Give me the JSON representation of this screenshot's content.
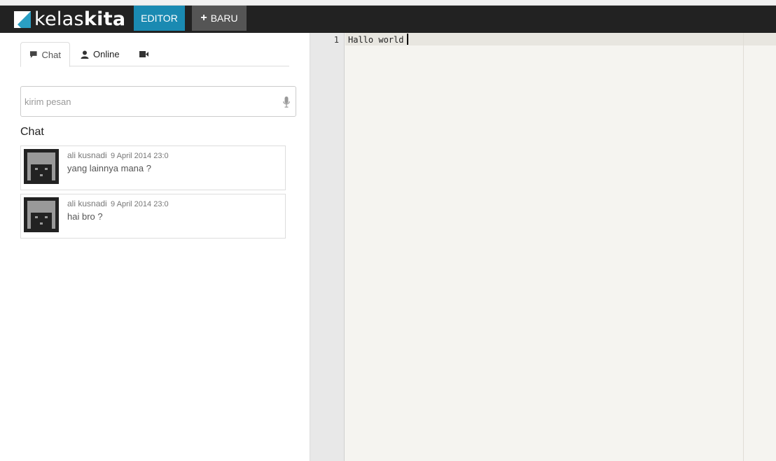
{
  "brand": {
    "light": "kelas",
    "bold": "kita"
  },
  "nav": {
    "editor_label": "EDITOR",
    "new_label": "BARU"
  },
  "tabs": {
    "chat_label": "Chat",
    "online_label": "Online"
  },
  "message_input": {
    "placeholder": "kirim pesan",
    "value": ""
  },
  "chat_heading": "Chat",
  "messages": [
    {
      "author": "ali kusnadi",
      "time": "9 April 2014 23:0",
      "text": "yang lainnya mana ?"
    },
    {
      "author": "ali kusnadi",
      "time": "9 April 2014 23:0",
      "text": "hai bro ?"
    }
  ],
  "editor": {
    "line_number": "1",
    "code": "Hallo world "
  },
  "colors": {
    "navbar": "#222222",
    "editor_tab": "#1a8ab2",
    "new_button": "#555555",
    "logo_accent": "#2a9fc4"
  }
}
